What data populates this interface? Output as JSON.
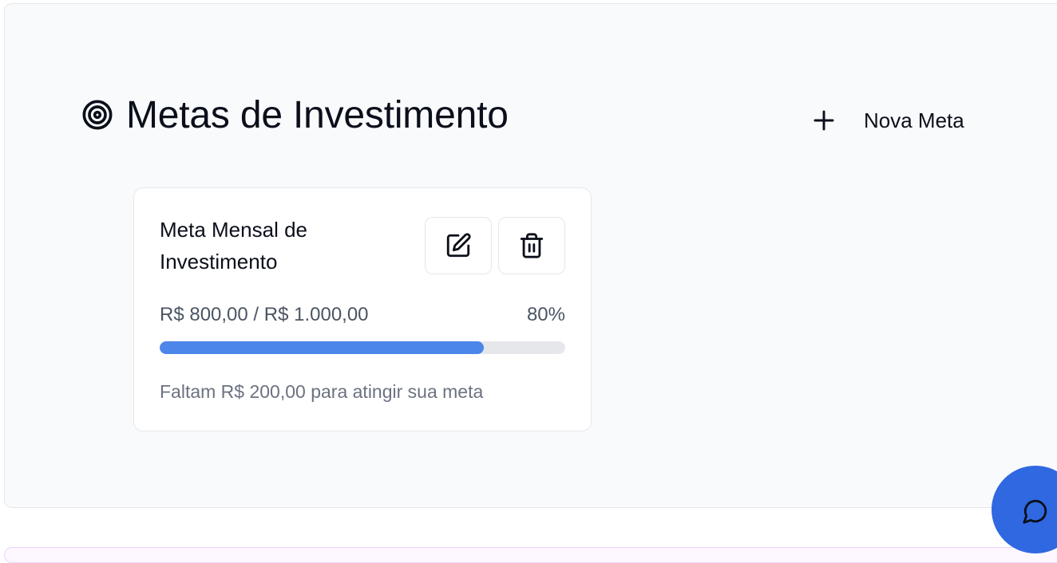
{
  "header": {
    "title": "Metas de Investimento",
    "icon": "target-icon",
    "new_goal_label": "Nova Meta",
    "new_goal_icon": "plus-icon"
  },
  "goals": [
    {
      "title": "Meta Mensal de Investimento",
      "amounts": "R$ 800,00 / R$ 1.000,00",
      "percent_label": "80%",
      "progress": 0.8,
      "remaining": "Faltam R$ 200,00 para atingir sua meta",
      "edit_icon": "edit-icon",
      "delete_icon": "trash-icon"
    }
  ],
  "chat": {
    "icon": "chat-bubble-icon"
  },
  "colors": {
    "accent": "#4c86ea",
    "fab": "#2f68e0",
    "panel_bg": "#f8fafc",
    "track": "#e5e7eb"
  }
}
